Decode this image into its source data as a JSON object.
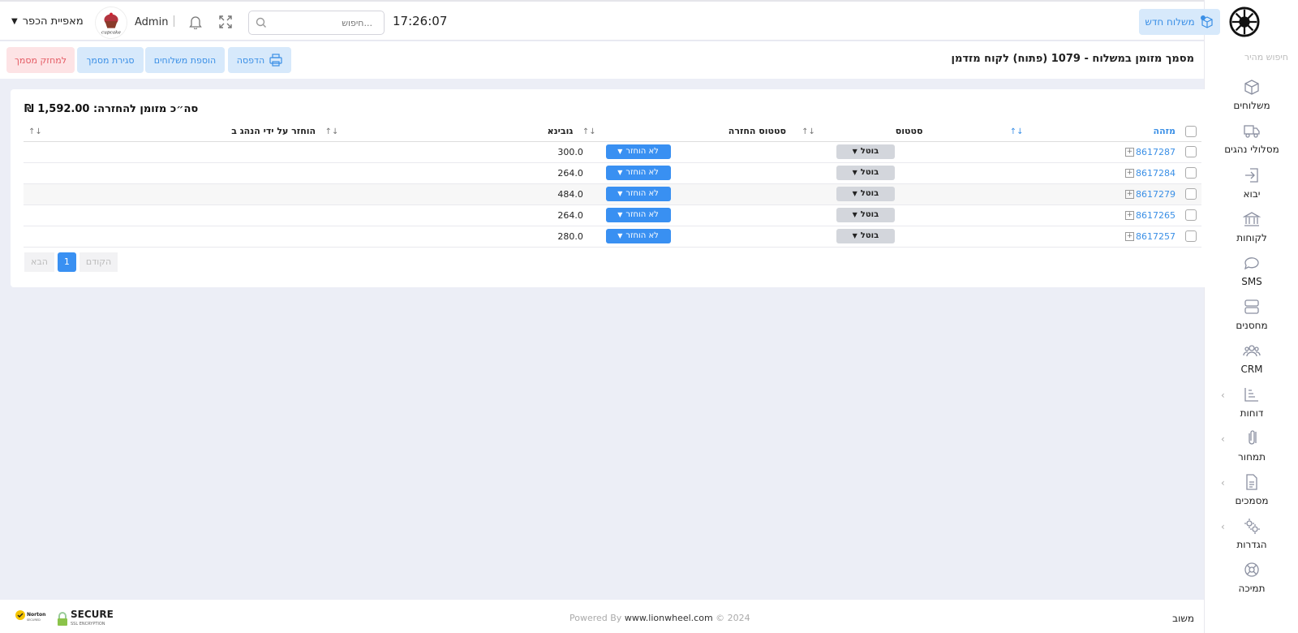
{
  "header": {
    "new_shipment_label": "משלוח חדש",
    "clock": "17:26:07",
    "search_placeholder": "חיפוש...",
    "admin_label": "Admin",
    "company_name": "מאפיית הכפר"
  },
  "sidebar": {
    "quick_search": "חיפוש מהיר",
    "items": [
      {
        "label": "משלוחים",
        "icon": "box-icon"
      },
      {
        "label": "מסלולי נהגים",
        "icon": "truck-icon"
      },
      {
        "label": "יבוא",
        "icon": "import-icon"
      },
      {
        "label": "לקוחות",
        "icon": "bank-icon"
      },
      {
        "label": "SMS",
        "icon": "chat-icon"
      },
      {
        "label": "מחסנים",
        "icon": "storage-icon"
      },
      {
        "label": "CRM",
        "icon": "users-icon"
      },
      {
        "label": "דוחות",
        "icon": "chart-icon"
      },
      {
        "label": "תמחור",
        "icon": "paperclip-icon"
      },
      {
        "label": "מסמכים",
        "icon": "document-icon"
      },
      {
        "label": "הגדרות",
        "icon": "settings-icon"
      },
      {
        "label": "תמיכה",
        "icon": "lifebuoy-icon"
      }
    ]
  },
  "document": {
    "title": "מסמך מזומן במשלוח - 1079 (פתוח)   לקוח מזדמן",
    "print_label": "הדפסה",
    "add_shipments_label": "הוספת משלוחים",
    "close_doc_label": "סגירת מסמך",
    "archive_label": "למחזק מסמך"
  },
  "summary": {
    "total_label": "סה״כ מזומן להחזרה: 1,592.00 ₪"
  },
  "table": {
    "headers": {
      "id": "מזהה",
      "status": "סטטוס",
      "return_status": "סטטוס החזרה",
      "collection": "גובינא",
      "returned_by": "הוחזר על ידי הנהג ב"
    },
    "rows": [
      {
        "id": "8617287",
        "status": "בוטל",
        "return_status": "לא הוחזר",
        "collection": "300.0",
        "returned_by": ""
      },
      {
        "id": "8617284",
        "status": "בוטל",
        "return_status": "לא הוחזר",
        "collection": "264.0",
        "returned_by": ""
      },
      {
        "id": "8617279",
        "status": "בוטל",
        "return_status": "לא הוחזר",
        "collection": "484.0",
        "returned_by": ""
      },
      {
        "id": "8617265",
        "status": "בוטל",
        "return_status": "לא הוחזר",
        "collection": "264.0",
        "returned_by": ""
      },
      {
        "id": "8617257",
        "status": "בוטל",
        "return_status": "לא הוחזר",
        "collection": "280.0",
        "returned_by": ""
      }
    ]
  },
  "pager": {
    "prev": "הקודם",
    "current": "1",
    "next": "הבא"
  },
  "footer": {
    "powered_by": "Powered By",
    "site": "www.lionwheel.com",
    "year": "© 2024",
    "feedback": "משוב",
    "secure": "SECURE",
    "secure_sub": "SSL ENCRYPTION",
    "norton": "Norton"
  },
  "colors": {
    "accent": "#3990f2",
    "danger": "#e45a63",
    "background": "#eceef6"
  }
}
